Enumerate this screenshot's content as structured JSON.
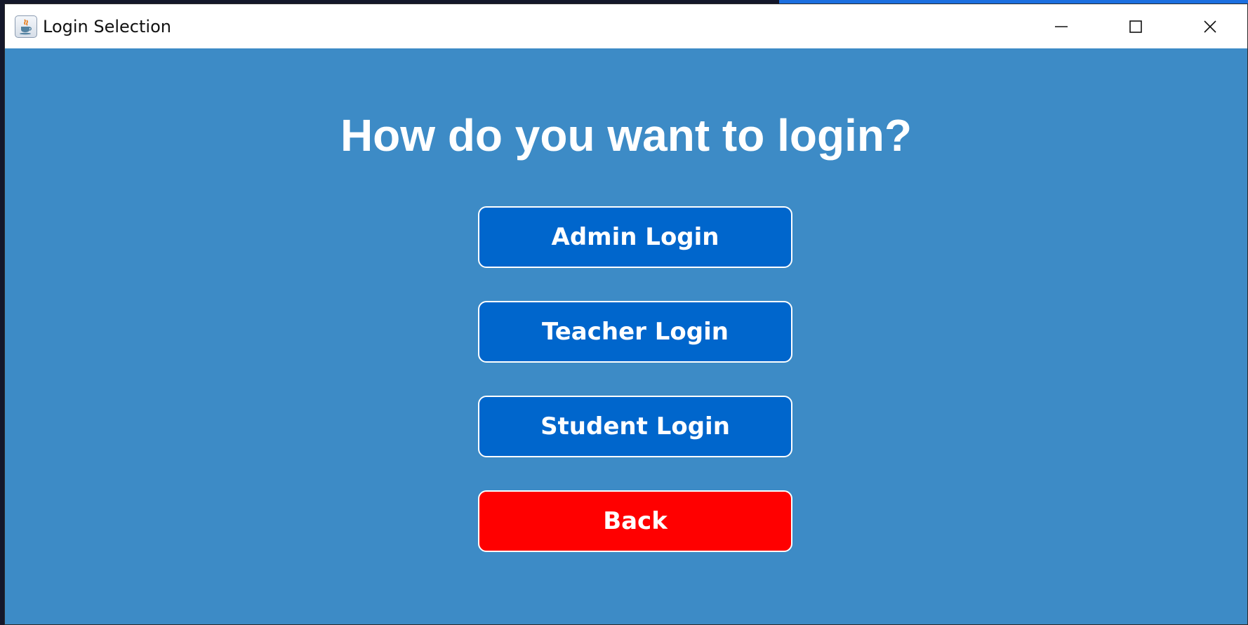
{
  "window": {
    "title": "Login Selection",
    "app_icon": "java-cup-icon",
    "controls": [
      "minimize-icon",
      "maximize-icon",
      "close-icon"
    ]
  },
  "main": {
    "heading": "How do you want to login?",
    "buttons": {
      "admin": "Admin Login",
      "teacher": "Teacher Login",
      "student": "Student Login",
      "back": "Back"
    }
  },
  "colors": {
    "background": "#3d8bc6",
    "button_primary": "#0066cc",
    "button_back": "#ff0000",
    "text": "#ffffff"
  }
}
